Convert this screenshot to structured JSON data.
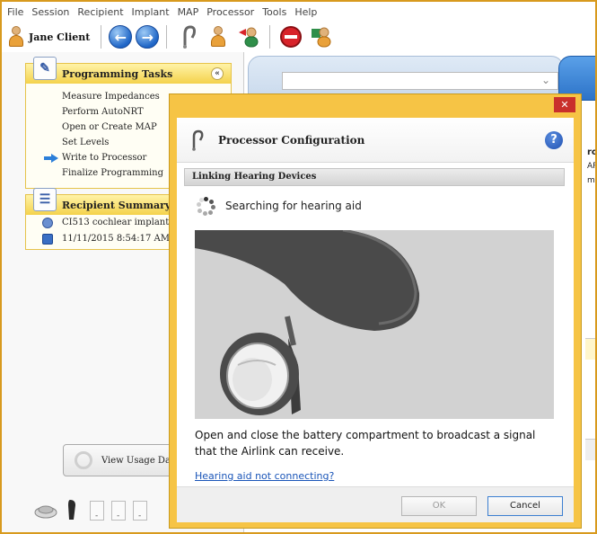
{
  "menu": [
    "File",
    "Session",
    "Recipient",
    "Implant",
    "MAP",
    "Processor",
    "Tools",
    "Help"
  ],
  "toolbar": {
    "client_name": "Jane Client",
    "icons": [
      "client-icon",
      "back-arrow-icon",
      "forward-arrow-icon",
      "hearing-device-icon",
      "patient-check-icon",
      "patient-transfer-icon",
      "stop-icon",
      "patient-flag-icon"
    ]
  },
  "programming_tasks": {
    "title": "Programming Tasks",
    "collapse_glyph": "«",
    "items": [
      {
        "label": "Measure Impedances"
      },
      {
        "label": "Perform AutoNRT"
      },
      {
        "label": "Open or Create MAP"
      },
      {
        "label": "Set Levels"
      },
      {
        "label": "Write to Processor",
        "current": true
      },
      {
        "label": "Finalize Programming"
      }
    ]
  },
  "recipient_summary": {
    "title": "Recipient Summary",
    "items": [
      {
        "label": "CI513 cochlear implant",
        "icon": "implant-icon"
      },
      {
        "label": "11/11/2015 8:54:17 AM",
        "icon": "session-icon"
      }
    ]
  },
  "usage_button": "View Usage Da",
  "background_fragments": {
    "r1": "ro",
    "r2": "AP",
    "r3": "mp"
  },
  "dialog": {
    "close_glyph": "✕",
    "title": "Processor Configuration",
    "help_glyph": "?",
    "section_title": "Linking Hearing Devices",
    "status_text": "Searching for hearing aid",
    "instruction": "Open and close the battery compartment to broadcast a signal that the Airlink can receive.",
    "link": "Hearing aid not connecting?",
    "ok_label": "OK",
    "ok_enabled": false,
    "cancel_label": "Cancel"
  },
  "colors": {
    "accent": "#f6c445",
    "link": "#1a55b8",
    "close": "#c9302c"
  }
}
